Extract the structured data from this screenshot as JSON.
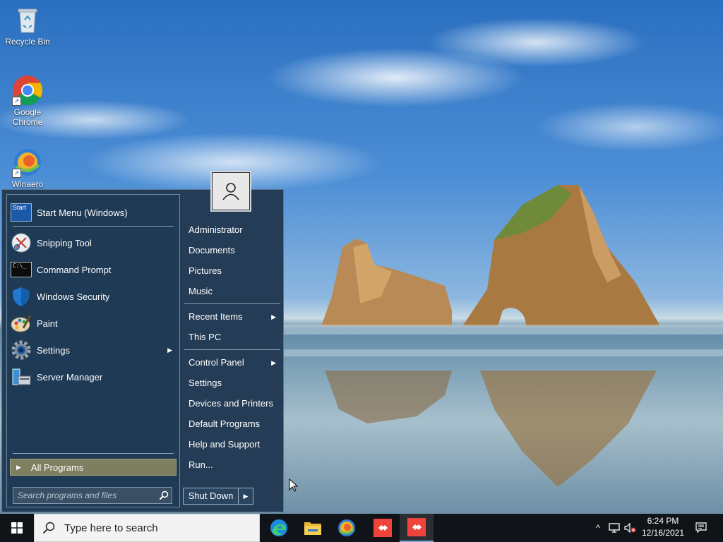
{
  "desktop": {
    "icons": [
      {
        "label": "Recycle Bin",
        "icon": "recycle-bin-icon"
      },
      {
        "label": "Google Chrome",
        "icon": "chrome-icon"
      },
      {
        "label": "Winaero",
        "icon": "winaero-icon"
      }
    ]
  },
  "start_menu": {
    "pinned": [
      {
        "label": "Start Menu (Windows)",
        "icon": "start-menu-app-icon"
      }
    ],
    "programs": [
      {
        "label": "Snipping Tool",
        "icon": "snipping-tool-icon"
      },
      {
        "label": "Command Prompt",
        "icon": "command-prompt-icon"
      },
      {
        "label": "Windows Security",
        "icon": "shield-icon"
      },
      {
        "label": "Paint",
        "icon": "paint-icon"
      },
      {
        "label": "Settings",
        "icon": "gear-icon",
        "has_submenu": true
      },
      {
        "label": "Server Manager",
        "icon": "server-manager-icon"
      }
    ],
    "all_programs_label": "All Programs",
    "search_placeholder": "Search programs and files",
    "right_items": [
      {
        "label": "Administrator"
      },
      {
        "label": "Documents"
      },
      {
        "label": "Pictures"
      },
      {
        "label": "Music"
      },
      {
        "label": "Recent Items",
        "has_submenu": true
      },
      {
        "label": "This PC"
      },
      {
        "label": "Control Panel",
        "has_submenu": true
      },
      {
        "label": "Settings"
      },
      {
        "label": "Devices and Printers"
      },
      {
        "label": "Default Programs"
      },
      {
        "label": "Help and Support"
      },
      {
        "label": "Run..."
      }
    ],
    "shutdown_label": "Shut Down",
    "start_icon_text": "Start"
  },
  "taskbar": {
    "search_placeholder": "Type here to search",
    "apps": [
      "edge-icon",
      "file-explorer-icon",
      "winaero-icon",
      "anydesk-icon",
      "anydesk-icon"
    ],
    "clock": {
      "time": "6:24 PM",
      "date": "12/16/2021"
    }
  },
  "colors": {
    "menu_bg": "#243c55",
    "all_programs_bg": "#7e7f5f",
    "taskbar_bg": "#101418"
  }
}
